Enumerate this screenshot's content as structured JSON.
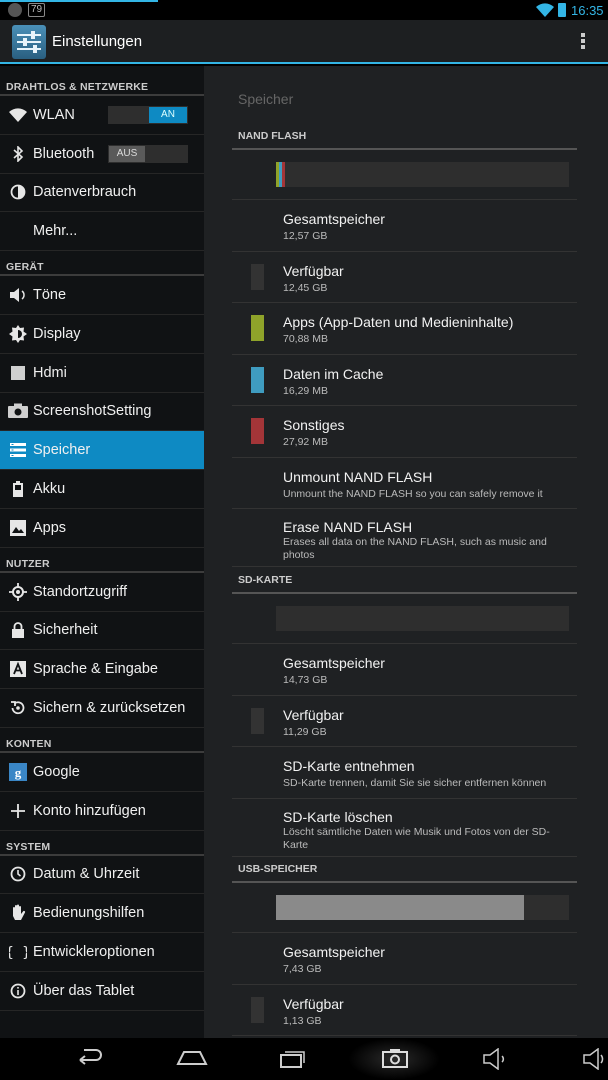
{
  "status_bar": {
    "badge": "79",
    "time": "16:35"
  },
  "action_bar": {
    "title": "Einstellungen"
  },
  "left_pane": {
    "sections": [
      {
        "header": "DRAHTLOS & NETZWERKE",
        "items": [
          {
            "label": "WLAN",
            "icon": "wifi-icon",
            "toggle": "AN"
          },
          {
            "label": "Bluetooth",
            "icon": "bluetooth-icon",
            "toggle": "AUS"
          },
          {
            "label": "Datenverbrauch",
            "icon": "data-usage-icon"
          },
          {
            "label": "Mehr...",
            "icon": ""
          }
        ]
      },
      {
        "header": "GERÄT",
        "items": [
          {
            "label": "Töne",
            "icon": "volume-icon"
          },
          {
            "label": "Display",
            "icon": "brightness-icon"
          },
          {
            "label": "Hdmi",
            "icon": "hdmi-icon"
          },
          {
            "label": "ScreenshotSetting",
            "icon": "camera-icon"
          },
          {
            "label": "Speicher",
            "icon": "storage-icon",
            "active": true
          },
          {
            "label": "Akku",
            "icon": "battery-icon"
          },
          {
            "label": "Apps",
            "icon": "apps-icon"
          }
        ]
      },
      {
        "header": "NUTZER",
        "items": [
          {
            "label": "Standortzugriff",
            "icon": "location-icon"
          },
          {
            "label": "Sicherheit",
            "icon": "lock-icon"
          },
          {
            "label": "Sprache & Eingabe",
            "icon": "language-icon"
          },
          {
            "label": "Sichern & zurücksetzen",
            "icon": "backup-icon"
          }
        ]
      },
      {
        "header": "KONTEN",
        "items": [
          {
            "label": "Google",
            "icon": "google-icon"
          },
          {
            "label": "Konto hinzufügen",
            "icon": "add-icon"
          }
        ]
      },
      {
        "header": "SYSTEM",
        "items": [
          {
            "label": "Datum & Uhrzeit",
            "icon": "clock-icon"
          },
          {
            "label": "Bedienungshilfen",
            "icon": "hand-icon"
          },
          {
            "label": "Entwickleroptionen",
            "icon": "braces-icon"
          },
          {
            "label": "Über das Tablet",
            "icon": "info-icon"
          }
        ]
      }
    ]
  },
  "right_pane": {
    "title": "Speicher",
    "nand": {
      "header": "NAND FLASH",
      "usage_fractions": {
        "apps": 0.0056,
        "cache": 0.0013,
        "misc": 0.0022
      },
      "rows": [
        {
          "title": "Gesamtspeicher",
          "sub": "12,57 GB"
        },
        {
          "title": "Verfügbar",
          "sub": "12,45 GB",
          "color": "#333333"
        },
        {
          "title": "Apps (App-Daten und Medieninhalte)",
          "sub": "70,88 MB",
          "color": "#8fa32a"
        },
        {
          "title": "Daten im Cache",
          "sub": "16,29 MB",
          "color": "#3f9cc0"
        },
        {
          "title": "Sonstiges",
          "sub": "27,92 MB",
          "color": "#a33538"
        },
        {
          "title": "Unmount NAND FLASH",
          "sub": "Unmount the NAND FLASH so you can safely remove it"
        },
        {
          "title": "Erase NAND FLASH",
          "sub": "Erases all data on the NAND FLASH, such as music and photos"
        }
      ]
    },
    "sd": {
      "header": "SD-KARTE",
      "rows": [
        {
          "title": "Gesamtspeicher",
          "sub": "14,73 GB"
        },
        {
          "title": "Verfügbar",
          "sub": "11,29 GB",
          "color": "#333333"
        },
        {
          "title": "SD-Karte entnehmen",
          "sub": "SD-Karte trennen, damit Sie sie sicher entfernen können"
        },
        {
          "title": "SD-Karte löschen",
          "sub": "Löscht sämtliche Daten wie Musik und Fotos von der SD-Karte"
        }
      ]
    },
    "usb": {
      "header": "USB-SPEICHER",
      "used_fraction": 0.848,
      "rows": [
        {
          "title": "Gesamtspeicher",
          "sub": "7,43 GB"
        },
        {
          "title": "Verfügbar",
          "sub": "1,13 GB",
          "color": "#333333"
        }
      ]
    }
  },
  "colors": {
    "accent": "#33b5e5",
    "active_item": "#0e8ac3"
  }
}
